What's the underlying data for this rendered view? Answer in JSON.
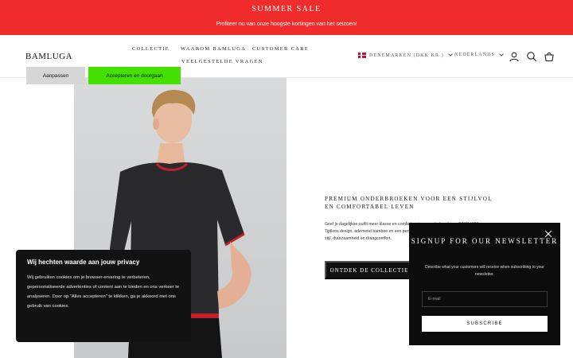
{
  "announcement": {
    "title": "SUMMER SALE",
    "subtitle": "Profiteer nu van onze hoogste kortingen van het seizoen!",
    "background": "#ef2b2b"
  },
  "header": {
    "logo": "BAMLUGA",
    "nav": [
      "COLLECTIE",
      "WAAROM BAMLUGA",
      "CUSTOMER CARE",
      "VEELGESTELDE VRAGEN"
    ],
    "country": "DENEMARKEN (DKK KR.)",
    "language": "NEDERLANDS",
    "icons": [
      "account-icon",
      "search-icon",
      "cart-icon"
    ]
  },
  "hero": {
    "heading": "PREMIUM ONDERBROEKEN VOOR EEN STIJLVOL EN COMFORTABEL LEVEN",
    "body": "Geef je dagelijkse outfit meer klasse en comfort met een onderbroek van BAMLUGA. Tijdloos design, ademend bamboe en een perfecte pasvorm - de ideale combinatie van stijl, duurzaamheid en draagcomfort.",
    "cta": "ONTDEK DE COLLECTIE"
  },
  "cookie": {
    "title": "Wij hechten waarde aan jouw privacy",
    "text": "Wij gebruiken cookies om je browser-ervaring te verbeteren, gepersonaliseerde advertenties of content aan te bieden en ons verkeer te analyseren. Door op \"Alles accepteren\" te klikken, ga je akkoord met ons gebruik van cookies.",
    "customize": "Aanpassen",
    "accept": "Accepteren en doorgaan",
    "accept_color": "#43e000"
  },
  "newsletter": {
    "title": "SIGNUP FOR OUR NEWSLETTER",
    "description": "Describe what your customers will receive when subscribing to your newsletter.",
    "email_placeholder": "E-mail",
    "subscribe": "SUBSCRIBE"
  }
}
